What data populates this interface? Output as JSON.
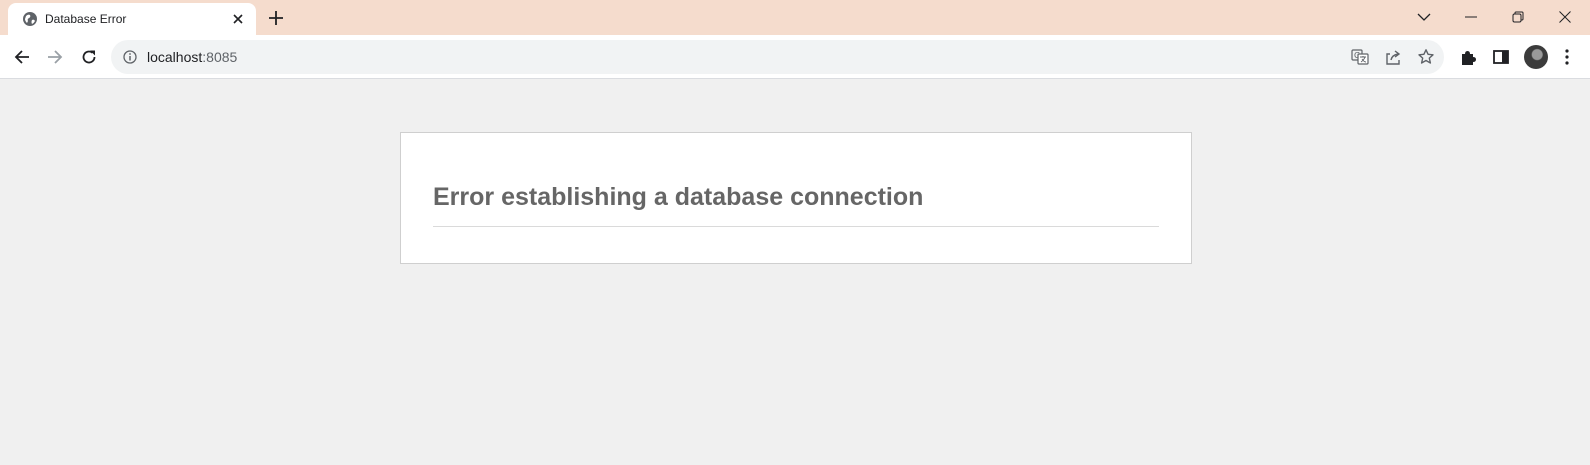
{
  "browser": {
    "tab": {
      "title": "Database Error",
      "favicon": "globe-icon"
    },
    "address_bar": {
      "host": "localhost",
      "port": ":8085"
    },
    "colors": {
      "tabstrip": "#f5dccd",
      "page_background": "#f0f0f0"
    }
  },
  "page": {
    "error_heading": "Error establishing a database connection"
  }
}
